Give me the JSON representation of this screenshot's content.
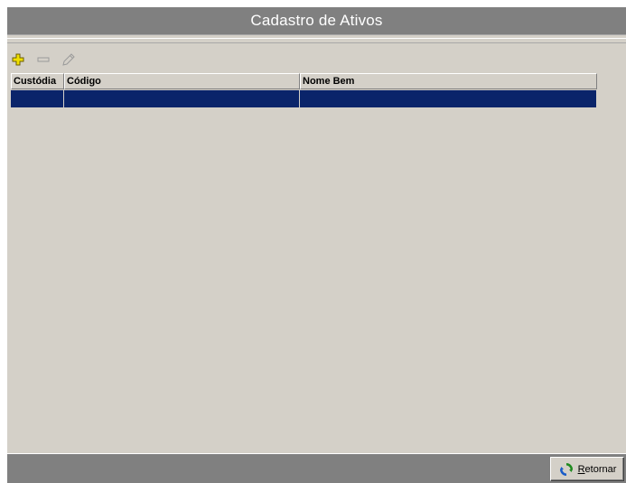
{
  "window": {
    "title": "Cadastro de Ativos"
  },
  "toolbar": {
    "add_icon": "plus-icon",
    "remove_icon": "minus-icon",
    "edit_icon": "pencil-icon"
  },
  "grid": {
    "columns": [
      "Custódia",
      "Código",
      "Nome Bem"
    ],
    "rows": [
      [
        "",
        "",
        ""
      ]
    ],
    "selected_row_color": "#0a246a"
  },
  "footer": {
    "return_button": {
      "label_first": "R",
      "label_rest": "etornar",
      "icon": "refresh-icon"
    }
  },
  "colors": {
    "titlebar": "#808080",
    "face": "#d4d0c8",
    "selection": "#0a246a",
    "add_icon": "#f0e000"
  }
}
